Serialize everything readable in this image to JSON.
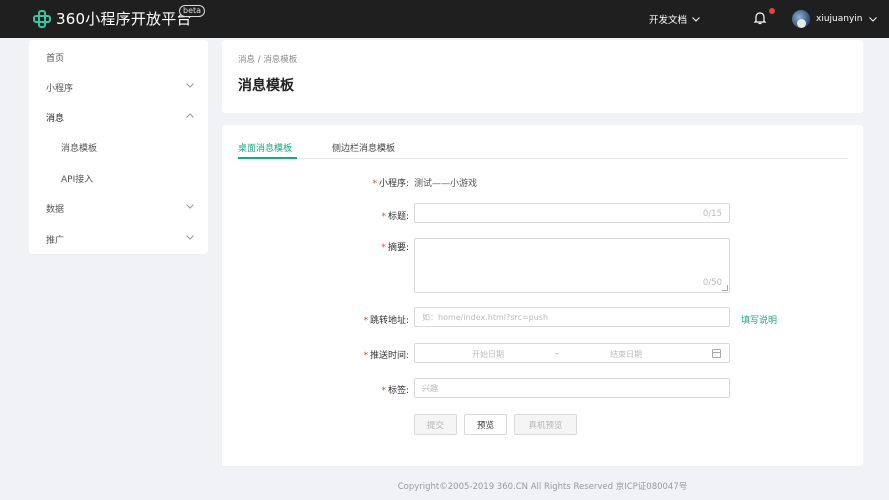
{
  "header": {
    "logo_text": "360小程序开放平台",
    "beta": "beta",
    "dev_docs": "开发文档",
    "username": "xiujuanyin",
    "colors": {
      "bar": "#1f1f1f",
      "accent": "#1ba784",
      "badge": "#e6433a"
    }
  },
  "sidebar": {
    "items": [
      {
        "label": "首页",
        "icon": ""
      },
      {
        "label": "小程序",
        "icon": "chevron-down-icon"
      },
      {
        "label": "消息",
        "icon": "chevron-up-icon"
      },
      {
        "label": "消息模板",
        "icon": ""
      },
      {
        "label": "API接入",
        "icon": ""
      },
      {
        "label": "数据",
        "icon": "chevron-down-icon"
      },
      {
        "label": "推广",
        "icon": "chevron-down-icon"
      }
    ]
  },
  "page": {
    "breadcrumb": "消息 / 消息模板",
    "title": "消息模板"
  },
  "tabs": [
    {
      "label": "桌面消息模板",
      "active": true
    },
    {
      "label": "侧边栏消息模板",
      "active": false
    }
  ],
  "form": {
    "required_mark": "*",
    "miniprogram": {
      "label": "小程序:",
      "value": "测试——小游戏"
    },
    "title": {
      "label": "标题:",
      "counter": "0/15"
    },
    "summary": {
      "label": "摘要:",
      "counter": "0/50"
    },
    "jump": {
      "label": "跳转地址:",
      "placeholder": "如：home/index.html?src=push",
      "help_link": "填写说明"
    },
    "push_time": {
      "label": "推送时间:",
      "start_placeholder": "开始日期",
      "separator": "–",
      "end_placeholder": "结束日期"
    },
    "tags": {
      "label": "标签:",
      "placeholder": "兴趣"
    }
  },
  "buttons": {
    "submit": "提交",
    "preview": "预览",
    "device_preview": "真机预览"
  },
  "footer": {
    "copyright": "Copyright©2005-2019 360.CN All Rights Reserved 京ICP证080047号"
  }
}
